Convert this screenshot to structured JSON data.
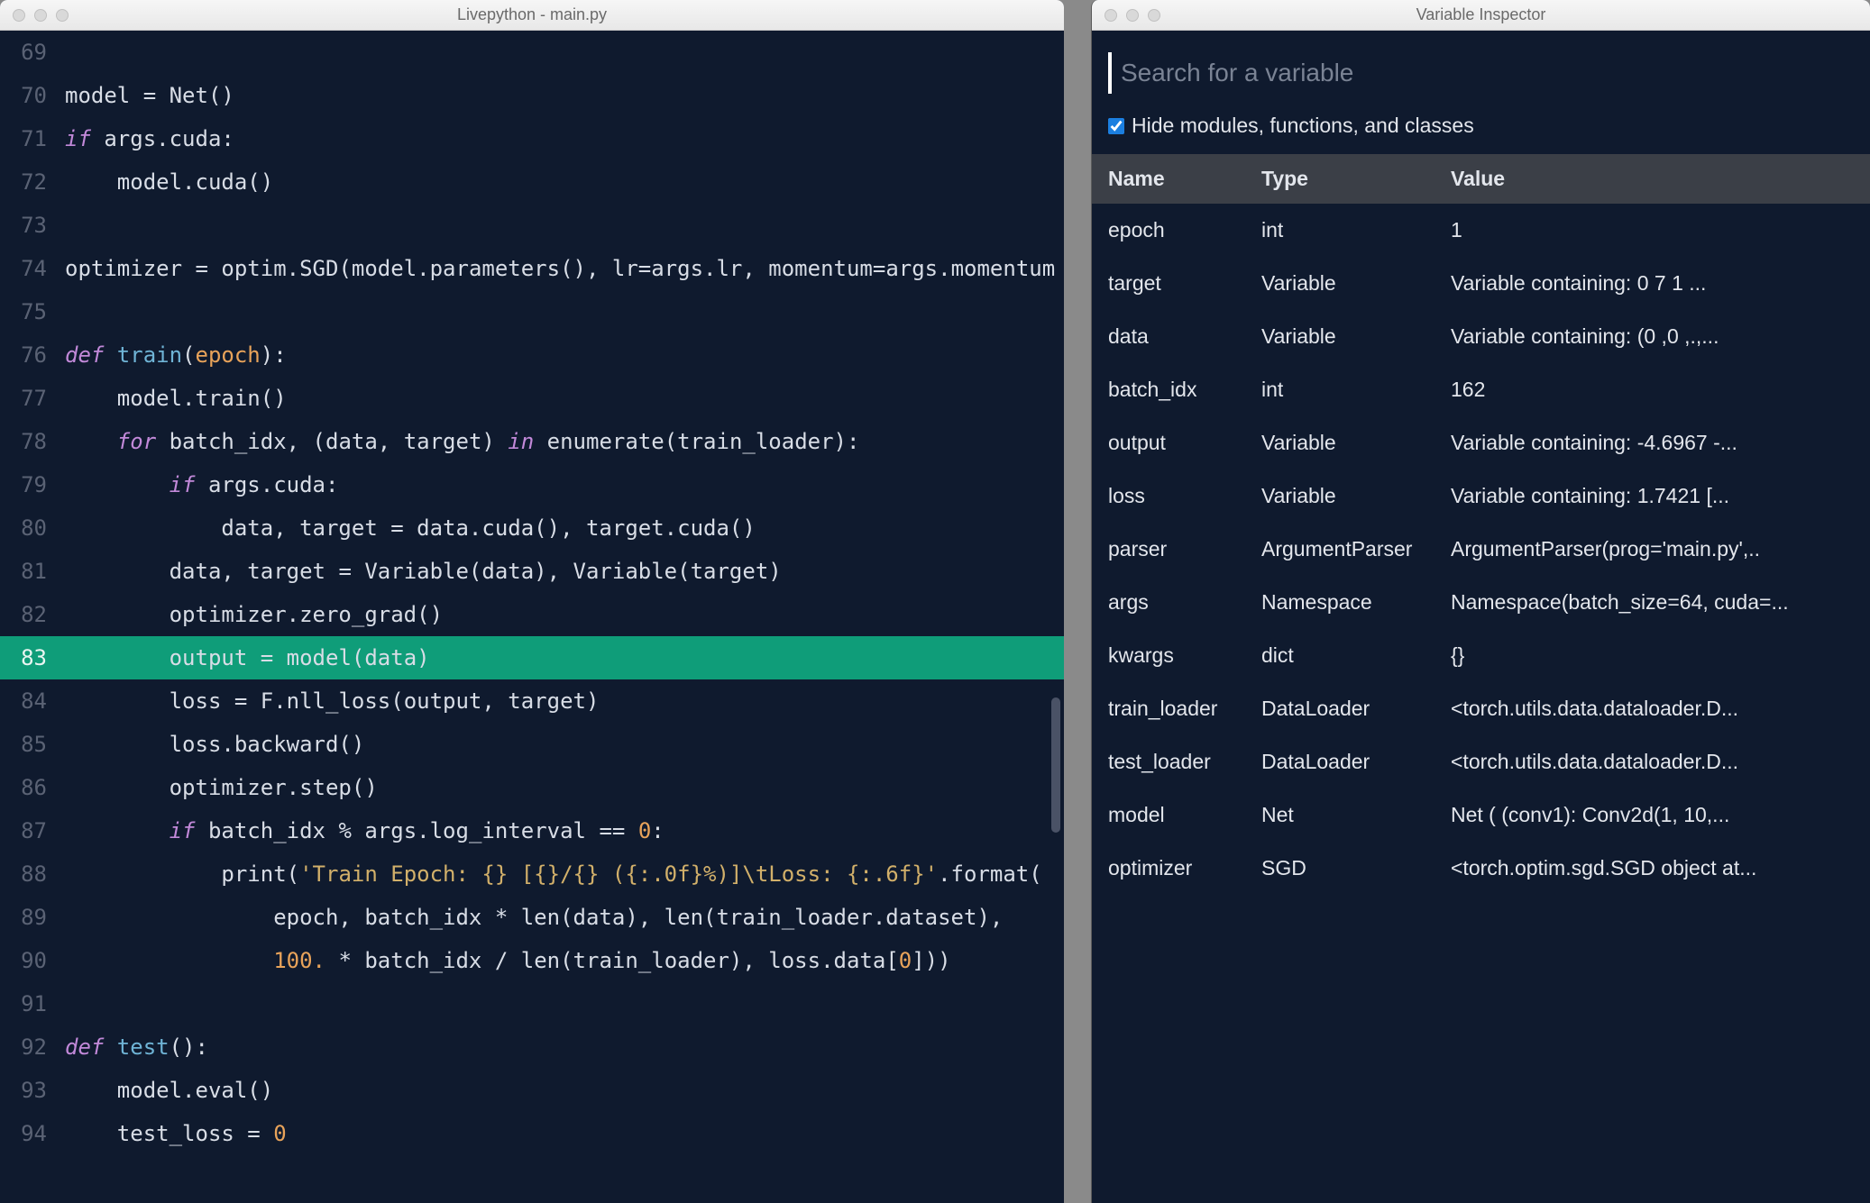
{
  "editor": {
    "title": "Livepython - main.py",
    "highlighted_line_num": 83,
    "lines": [
      {
        "num": 69,
        "tokens": []
      },
      {
        "num": 70,
        "tokens": [
          {
            "cls": "tok-white",
            "t": "model "
          },
          {
            "cls": "tok-op",
            "t": "="
          },
          {
            "cls": "tok-white",
            "t": " Net()"
          }
        ]
      },
      {
        "num": 71,
        "tokens": [
          {
            "cls": "tok-kw",
            "t": "if"
          },
          {
            "cls": "tok-white",
            "t": " args.cuda:"
          }
        ]
      },
      {
        "num": 72,
        "tokens": [
          {
            "cls": "tok-white",
            "t": "    model.cuda()"
          }
        ]
      },
      {
        "num": 73,
        "tokens": []
      },
      {
        "num": 74,
        "tokens": [
          {
            "cls": "tok-white",
            "t": "optimizer "
          },
          {
            "cls": "tok-op",
            "t": "="
          },
          {
            "cls": "tok-white",
            "t": " optim.SGD(model.parameters(), lr"
          },
          {
            "cls": "tok-op",
            "t": "="
          },
          {
            "cls": "tok-white",
            "t": "args.lr, momentum"
          },
          {
            "cls": "tok-op",
            "t": "="
          },
          {
            "cls": "tok-white",
            "t": "args.momentum"
          }
        ]
      },
      {
        "num": 75,
        "tokens": []
      },
      {
        "num": 76,
        "tokens": [
          {
            "cls": "tok-def",
            "t": "def "
          },
          {
            "cls": "tok-fn",
            "t": "train"
          },
          {
            "cls": "tok-white",
            "t": "("
          },
          {
            "cls": "tok-param",
            "t": "epoch"
          },
          {
            "cls": "tok-white",
            "t": "):"
          }
        ]
      },
      {
        "num": 77,
        "tokens": [
          {
            "cls": "tok-white",
            "t": "    model.train()"
          }
        ]
      },
      {
        "num": 78,
        "tokens": [
          {
            "cls": "tok-white",
            "t": "    "
          },
          {
            "cls": "tok-kw",
            "t": "for"
          },
          {
            "cls": "tok-white",
            "t": " batch_idx, (data, target) "
          },
          {
            "cls": "tok-kw",
            "t": "in"
          },
          {
            "cls": "tok-white",
            "t": " enumerate(train_loader):"
          }
        ]
      },
      {
        "num": 79,
        "tokens": [
          {
            "cls": "tok-white",
            "t": "        "
          },
          {
            "cls": "tok-kw",
            "t": "if"
          },
          {
            "cls": "tok-white",
            "t": " args.cuda:"
          }
        ]
      },
      {
        "num": 80,
        "tokens": [
          {
            "cls": "tok-white",
            "t": "            data, target "
          },
          {
            "cls": "tok-op",
            "t": "="
          },
          {
            "cls": "tok-white",
            "t": " data.cuda(), target.cuda()"
          }
        ]
      },
      {
        "num": 81,
        "tokens": [
          {
            "cls": "tok-white",
            "t": "        data, target "
          },
          {
            "cls": "tok-op",
            "t": "="
          },
          {
            "cls": "tok-white",
            "t": " Variable(data), Variable(target)"
          }
        ]
      },
      {
        "num": 82,
        "tokens": [
          {
            "cls": "tok-white",
            "t": "        optimizer.zero_grad()"
          }
        ]
      },
      {
        "num": 83,
        "tokens": [
          {
            "cls": "tok-white",
            "t": "        output "
          },
          {
            "cls": "tok-op",
            "t": "="
          },
          {
            "cls": "tok-white",
            "t": " model(data)"
          }
        ]
      },
      {
        "num": 84,
        "tokens": [
          {
            "cls": "tok-white",
            "t": "        loss "
          },
          {
            "cls": "tok-op",
            "t": "="
          },
          {
            "cls": "tok-white",
            "t": " F.nll_loss(output, target)"
          }
        ]
      },
      {
        "num": 85,
        "tokens": [
          {
            "cls": "tok-white",
            "t": "        loss.backward()"
          }
        ]
      },
      {
        "num": 86,
        "tokens": [
          {
            "cls": "tok-white",
            "t": "        optimizer.step()"
          }
        ]
      },
      {
        "num": 87,
        "tokens": [
          {
            "cls": "tok-white",
            "t": "        "
          },
          {
            "cls": "tok-kw",
            "t": "if"
          },
          {
            "cls": "tok-white",
            "t": " batch_idx "
          },
          {
            "cls": "tok-op",
            "t": "%"
          },
          {
            "cls": "tok-white",
            "t": " args.log_interval "
          },
          {
            "cls": "tok-op",
            "t": "=="
          },
          {
            "cls": "tok-white",
            "t": " "
          },
          {
            "cls": "tok-num",
            "t": "0"
          },
          {
            "cls": "tok-white",
            "t": ":"
          }
        ]
      },
      {
        "num": 88,
        "tokens": [
          {
            "cls": "tok-white",
            "t": "            print("
          },
          {
            "cls": "tok-str",
            "t": "'Train Epoch: {} [{}/{} ({:.0f}%)]\\tLoss: {:.6f}'"
          },
          {
            "cls": "tok-white",
            "t": ".format("
          }
        ]
      },
      {
        "num": 89,
        "tokens": [
          {
            "cls": "tok-white",
            "t": "                epoch, batch_idx "
          },
          {
            "cls": "tok-op",
            "t": "*"
          },
          {
            "cls": "tok-white",
            "t": " len(data), len(train_loader.dataset),"
          }
        ]
      },
      {
        "num": 90,
        "tokens": [
          {
            "cls": "tok-white",
            "t": "                "
          },
          {
            "cls": "tok-num",
            "t": "100."
          },
          {
            "cls": "tok-white",
            "t": " "
          },
          {
            "cls": "tok-op",
            "t": "*"
          },
          {
            "cls": "tok-white",
            "t": " batch_idx "
          },
          {
            "cls": "tok-op",
            "t": "/"
          },
          {
            "cls": "tok-white",
            "t": " len(train_loader), loss.data["
          },
          {
            "cls": "tok-num",
            "t": "0"
          },
          {
            "cls": "tok-white",
            "t": "]))"
          }
        ]
      },
      {
        "num": 91,
        "tokens": []
      },
      {
        "num": 92,
        "tokens": [
          {
            "cls": "tok-def",
            "t": "def "
          },
          {
            "cls": "tok-fn",
            "t": "test"
          },
          {
            "cls": "tok-white",
            "t": "():"
          }
        ]
      },
      {
        "num": 93,
        "tokens": [
          {
            "cls": "tok-white",
            "t": "    model.eval()"
          }
        ]
      },
      {
        "num": 94,
        "tokens": [
          {
            "cls": "tok-white",
            "t": "    test_loss "
          },
          {
            "cls": "tok-op",
            "t": "="
          },
          {
            "cls": "tok-white",
            "t": " "
          },
          {
            "cls": "tok-num",
            "t": "0"
          }
        ]
      }
    ]
  },
  "inspector": {
    "title": "Variable Inspector",
    "search_placeholder": "Search for a variable",
    "hide_checkbox_label": "Hide modules, functions, and classes",
    "hide_checkbox_checked": true,
    "columns": {
      "name": "Name",
      "type": "Type",
      "value": "Value"
    },
    "rows": [
      {
        "name": "epoch",
        "type": "int",
        "value": "1"
      },
      {
        "name": "target",
        "type": "Variable",
        "value": "Variable containing: 0 7 1 ..."
      },
      {
        "name": "data",
        "type": "Variable",
        "value": "Variable containing: (0 ,0 ,.,..."
      },
      {
        "name": "batch_idx",
        "type": "int",
        "value": "162"
      },
      {
        "name": "output",
        "type": "Variable",
        "value": "Variable containing: -4.6967 -..."
      },
      {
        "name": "loss",
        "type": "Variable",
        "value": "Variable containing: 1.7421 [..."
      },
      {
        "name": "parser",
        "type": "ArgumentParser",
        "value": "ArgumentParser(prog='main.py',.."
      },
      {
        "name": "args",
        "type": "Namespace",
        "value": "Namespace(batch_size=64, cuda=..."
      },
      {
        "name": "kwargs",
        "type": "dict",
        "value": "{}"
      },
      {
        "name": "train_loader",
        "type": "DataLoader",
        "value": "<torch.utils.data.dataloader.D..."
      },
      {
        "name": "test_loader",
        "type": "DataLoader",
        "value": "<torch.utils.data.dataloader.D..."
      },
      {
        "name": "model",
        "type": "Net",
        "value": "Net ( (conv1): Conv2d(1, 10,..."
      },
      {
        "name": "optimizer",
        "type": "SGD",
        "value": "<torch.optim.sgd.SGD object at..."
      }
    ]
  }
}
